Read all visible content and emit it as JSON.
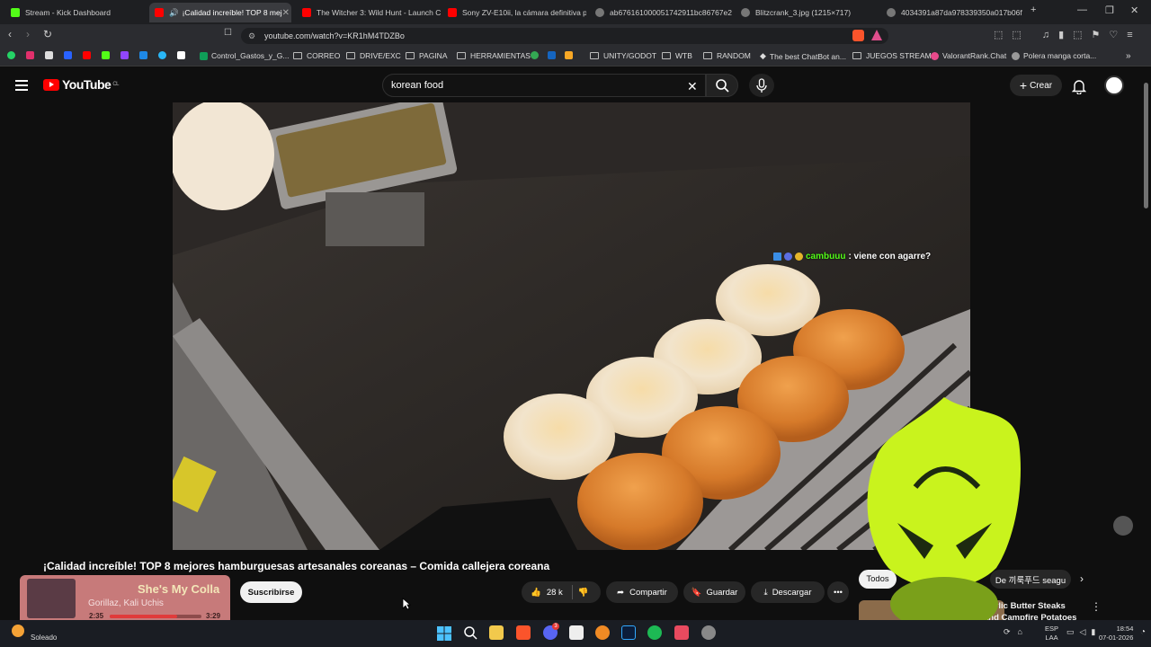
{
  "browser": {
    "tabs": [
      {
        "label": "Stream - Kick Dashboard",
        "color": "#53fc18"
      },
      {
        "label": "¡Calidad increíble! TOP 8 mej",
        "color": "#ff0000",
        "active": true
      },
      {
        "label": "The Witcher 3: Wild Hunt - Launch C",
        "color": "#ff0000"
      },
      {
        "label": "Sony ZV-E10ii, la cámara definitiva p",
        "color": "#ff0000"
      },
      {
        "label": "ab6761610000517429​11bc86767e2",
        "color": "#888888"
      },
      {
        "label": "Blitzcrank_3.jpg (1215×717)",
        "color": "#888888"
      },
      {
        "label": "4034391a87da978339350a017b06f",
        "color": "#888888"
      }
    ],
    "url": "youtube.com/watch?v=KR1hM4TDZBo",
    "bookmarks": [
      "Control_Gastos_y_G...",
      "CORREO",
      "DRIVE/EXC",
      "PAGINA",
      "HERRAMIENTAS",
      "UNITY/GODOT",
      "WTB",
      "RANDOM",
      "The best ChatBot an...",
      "JUEGOS STREAM",
      "ValorantRank.Chat",
      "Polera manga corta..."
    ]
  },
  "youtube": {
    "logo": "YouTube",
    "region": "CL",
    "search_value": "korean food",
    "create_label": "Crear"
  },
  "video": {
    "chat_user": "cambuuu",
    "chat_text": ": viene con agarre?",
    "title": "¡Calidad increíble! TOP 8 mejores hamburguesas artesanales coreanas – Comida callejera coreana",
    "subscribe_label": "Suscribirse",
    "likes": "28 k",
    "share_label": "Compartir",
    "save_label": "Guardar",
    "download_label": "Descargar"
  },
  "sidebar": {
    "chips": [
      "Todos",
      "De 끼룩푸드 seagu"
    ],
    "next_title": "Garlic Butter Steaks and Campfire Potatoes"
  },
  "music": {
    "song": "She's My Colla",
    "artist": "Gorillaz, Kali Uchis",
    "elapsed": "2:35",
    "total": "3:29",
    "progress": 0.74
  },
  "taskbar": {
    "weather": "Soleado",
    "lang": "ESP",
    "layout": "LAA",
    "time": "18:54",
    "date": "07-01-2026",
    "discord_badge": "3"
  }
}
